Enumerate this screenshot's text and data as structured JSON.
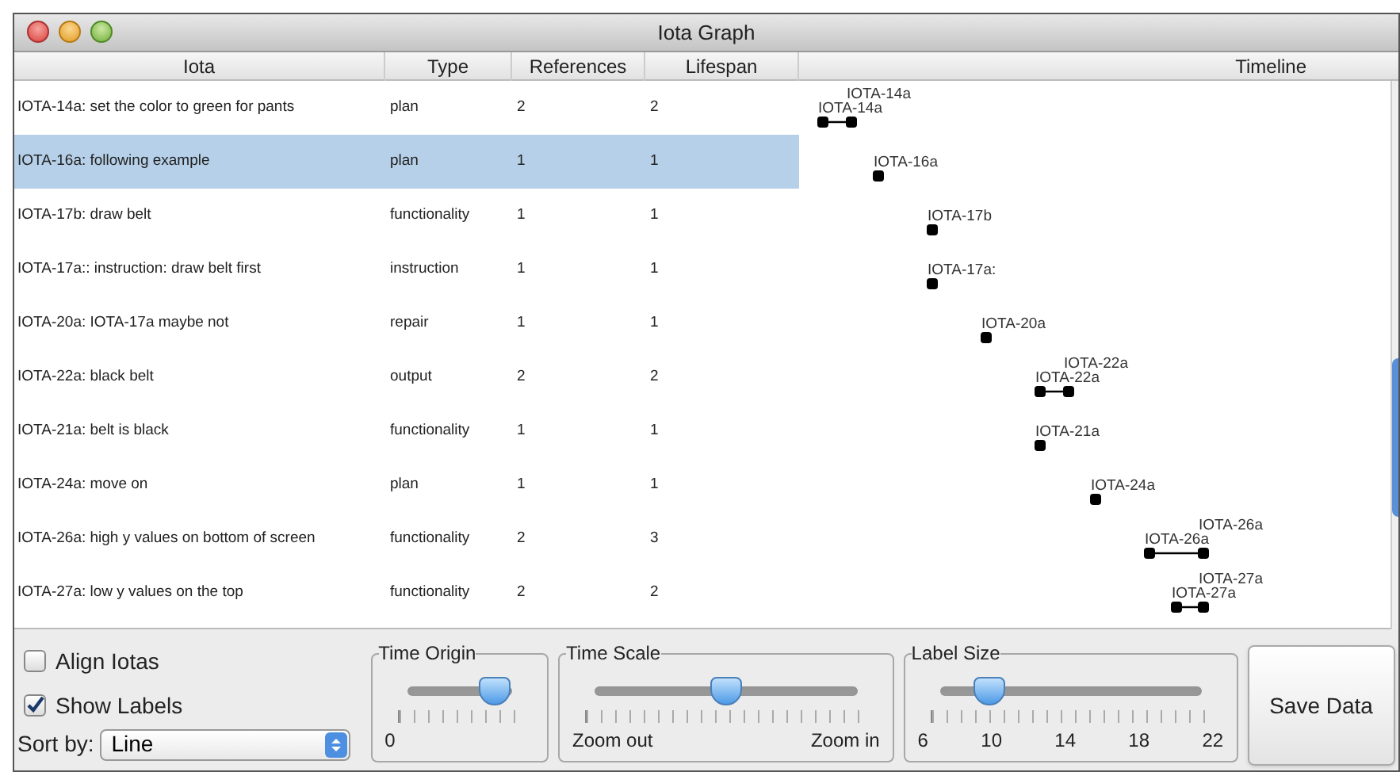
{
  "window": {
    "title": "Iota Graph"
  },
  "table": {
    "columns": [
      "Iota",
      "Type",
      "References",
      "Lifespan",
      "Timeline"
    ],
    "rows": [
      {
        "iota": "IOTA-14a: set the color to green for pants",
        "type": "plan",
        "references": "2",
        "lifespan": "2",
        "selected": false,
        "timeline_labels": [
          "IOTA-14a",
          "IOTA-14a"
        ]
      },
      {
        "iota": "IOTA-16a: following example",
        "type": "plan",
        "references": "1",
        "lifespan": "1",
        "selected": true,
        "timeline_labels": [
          "IOTA-16a"
        ]
      },
      {
        "iota": "IOTA-17b: draw belt",
        "type": "functionality",
        "references": "1",
        "lifespan": "1",
        "selected": false,
        "timeline_labels": [
          "IOTA-17b"
        ]
      },
      {
        "iota": "IOTA-17a:: instruction: draw belt first",
        "type": "instruction",
        "references": "1",
        "lifespan": "1",
        "selected": false,
        "timeline_labels": [
          "IOTA-17a:"
        ]
      },
      {
        "iota": "IOTA-20a: IOTA-17a maybe not",
        "type": "repair",
        "references": "1",
        "lifespan": "1",
        "selected": false,
        "timeline_labels": [
          "IOTA-20a"
        ]
      },
      {
        "iota": "IOTA-22a: black belt",
        "type": "output",
        "references": "2",
        "lifespan": "2",
        "selected": false,
        "timeline_labels": [
          "IOTA-22a",
          "IOTA-22a"
        ]
      },
      {
        "iota": "IOTA-21a: belt is black",
        "type": "functionality",
        "references": "1",
        "lifespan": "1",
        "selected": false,
        "timeline_labels": [
          "IOTA-21a"
        ]
      },
      {
        "iota": "IOTA-24a: move on",
        "type": "plan",
        "references": "1",
        "lifespan": "1",
        "selected": false,
        "timeline_labels": [
          "IOTA-24a"
        ]
      },
      {
        "iota": "IOTA-26a: high y values on bottom of screen",
        "type": "functionality",
        "references": "2",
        "lifespan": "3",
        "selected": false,
        "timeline_labels": [
          "IOTA-26a",
          "IOTA-26a"
        ]
      },
      {
        "iota": "IOTA-27a: low y values on the top",
        "type": "functionality",
        "references": "2",
        "lifespan": "2",
        "selected": false,
        "timeline_labels": [
          "IOTA-27a",
          "IOTA-27a"
        ]
      }
    ]
  },
  "options": [
    {
      "label": "Align Iotas",
      "checked": false
    },
    {
      "label": "Show Labels",
      "checked": true
    }
  ],
  "sort": {
    "label": "Sort by:",
    "value": "Line"
  },
  "sliders": [
    {
      "title": "Time Origin",
      "level": 0.84,
      "tick_labels": [
        "0"
      ]
    },
    {
      "title": "Time Scale",
      "level": 0.5,
      "tick_labels": [
        "Zoom out",
        "Zoom in"
      ]
    },
    {
      "title": "Label Size",
      "level": 0.19,
      "tick_labels": [
        "6",
        "10",
        "14",
        "18",
        "22"
      ]
    }
  ],
  "save_button": "Save Data"
}
